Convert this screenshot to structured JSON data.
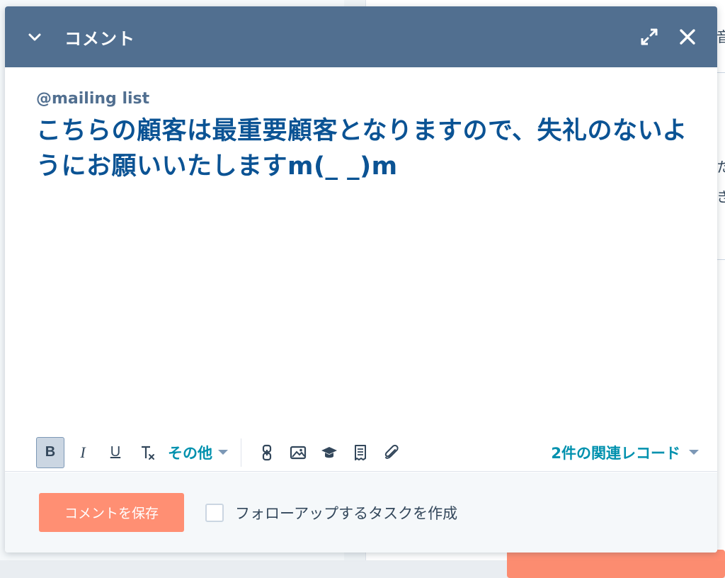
{
  "background": {
    "right_snippets": [
      "音",
      "た",
      "き"
    ]
  },
  "header": {
    "title": "コメント",
    "icons": {
      "collapse": "chevron-down-icon",
      "expand": "expand-icon",
      "close": "close-icon"
    },
    "color": "#516f90"
  },
  "editor": {
    "mention": "@mailing list",
    "comment_text": "こちらの顧客は最重要顧客となりますので、失礼のないようにお願いいたしますm(_ _)m",
    "text_color": "#0b5394"
  },
  "toolbar": {
    "bold": "B",
    "italic": "I",
    "underline": "U",
    "clear_format": "T",
    "more_label": "その他",
    "icons": [
      "link-icon",
      "image-icon",
      "knowledge-icon",
      "snippet-icon",
      "attachment-icon"
    ],
    "related_records_label": "2件の関連レコード"
  },
  "footer": {
    "save_label": "コメントを保存",
    "followup_label": "フォローアップするタスクを作成",
    "followup_checked": false,
    "save_color": "#ff8f73"
  }
}
